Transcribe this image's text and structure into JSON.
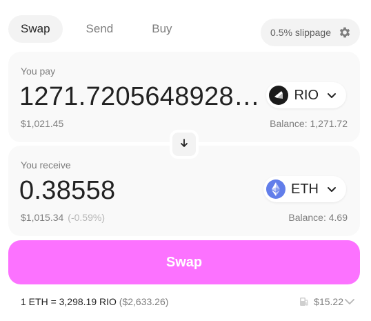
{
  "tabs": [
    {
      "label": "Swap",
      "active": true
    },
    {
      "label": "Send",
      "active": false
    },
    {
      "label": "Buy",
      "active": false
    }
  ],
  "slippage": {
    "label": "0.5% slippage",
    "icon": "gear-icon"
  },
  "pay": {
    "label": "You pay",
    "amount": "1271.7205648928…",
    "usd": "$1,021.45",
    "balance": "Balance: 1,271.72",
    "token": {
      "symbol": "RIO",
      "icon": "rio-token-icon",
      "color": "#1b1b1b"
    }
  },
  "flip": {
    "icon": "arrow-down-icon"
  },
  "receive": {
    "label": "You receive",
    "amount": "0.38558",
    "usd": "$1,015.34",
    "delta": "(-0.59%)",
    "balance": "Balance: 4.69",
    "token": {
      "symbol": "ETH",
      "icon": "eth-token-icon",
      "color": "#627eea"
    }
  },
  "swap_button": {
    "label": "Swap",
    "color": "#fc72ff"
  },
  "footer": {
    "rate": "1 ETH = 3,298.19 RIO",
    "rate_usd": "($2,633.26)",
    "gas": "$15.22",
    "gas_icon": "fuel-pump-icon"
  },
  "colors": {
    "accent": "#fc72ff",
    "panel": "#f9f9f9",
    "muted": "#7d7d7d"
  }
}
